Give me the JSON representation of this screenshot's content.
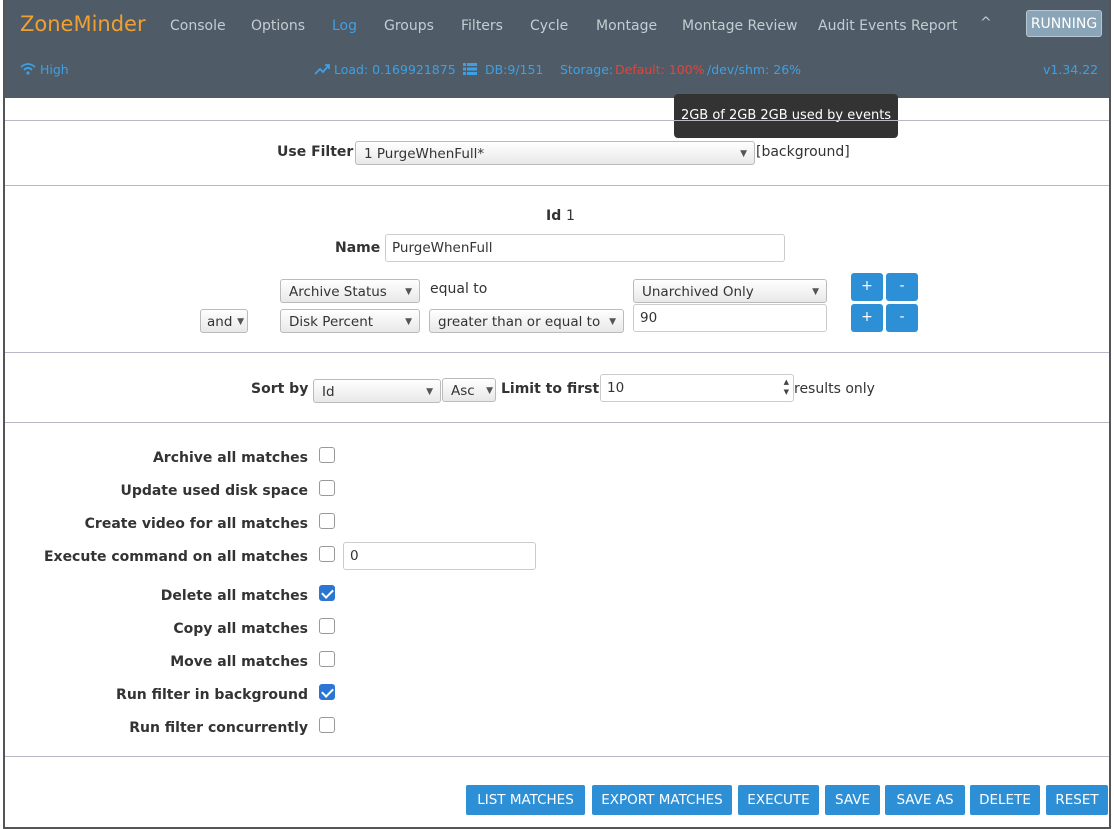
{
  "header": {
    "brand": "ZoneMinder",
    "nav": [
      "Console",
      "Options",
      "Log",
      "Groups",
      "Filters",
      "Cycle",
      "Montage",
      "Montage Review",
      "Audit Events Report"
    ],
    "active_nav": "Log",
    "collapse_icon": "^",
    "status_button": "RUNNING",
    "bandwidth": "High",
    "load": "Load: 0.169921875",
    "db": "DB:9/151",
    "storage_label": "Storage:",
    "storage_default": "Default: 100%",
    "storage_shm": "/dev/shm: 26%",
    "version": "v1.34.22"
  },
  "tooltip": "2GB of 2GB 2GB used by events",
  "filter_select": {
    "label": "Use Filter",
    "value": "1 PurgeWhenFull*",
    "suffix": "[background]"
  },
  "filter": {
    "id_label": "Id",
    "id_value": "1",
    "name_label": "Name",
    "name_value": "PurgeWhenFull",
    "terms": [
      {
        "conj": "",
        "attr": "Archive Status",
        "op": "equal to",
        "value": "Unarchived Only"
      },
      {
        "conj": "and",
        "attr": "Disk Percent",
        "op": "greater than or equal to",
        "value": "90"
      }
    ],
    "add_label": "+",
    "remove_label": "-"
  },
  "sort": {
    "label": "Sort by",
    "field": "Id",
    "direction": "Asc",
    "limit_label": "Limit to first",
    "limit_value": "10",
    "suffix": "results only"
  },
  "options": [
    {
      "label": "Archive all matches",
      "checked": false
    },
    {
      "label": "Update used disk space",
      "checked": false
    },
    {
      "label": "Create video for all matches",
      "checked": false
    },
    {
      "label": "Execute command on all matches",
      "checked": false,
      "input": "0"
    },
    {
      "label": "Delete all matches",
      "checked": true
    },
    {
      "label": "Copy all matches",
      "checked": false
    },
    {
      "label": "Move all matches",
      "checked": false
    },
    {
      "label": "Run filter in background",
      "checked": true
    },
    {
      "label": "Run filter concurrently",
      "checked": false
    }
  ],
  "actions": [
    "LIST MATCHES",
    "EXPORT MATCHES",
    "EXECUTE",
    "SAVE",
    "SAVE AS",
    "DELETE",
    "RESET"
  ],
  "colors": {
    "navbar": "#4f5b66",
    "brand": "#f0a030",
    "accent": "#2d8fd6",
    "storage_alert": "#e0463c"
  }
}
